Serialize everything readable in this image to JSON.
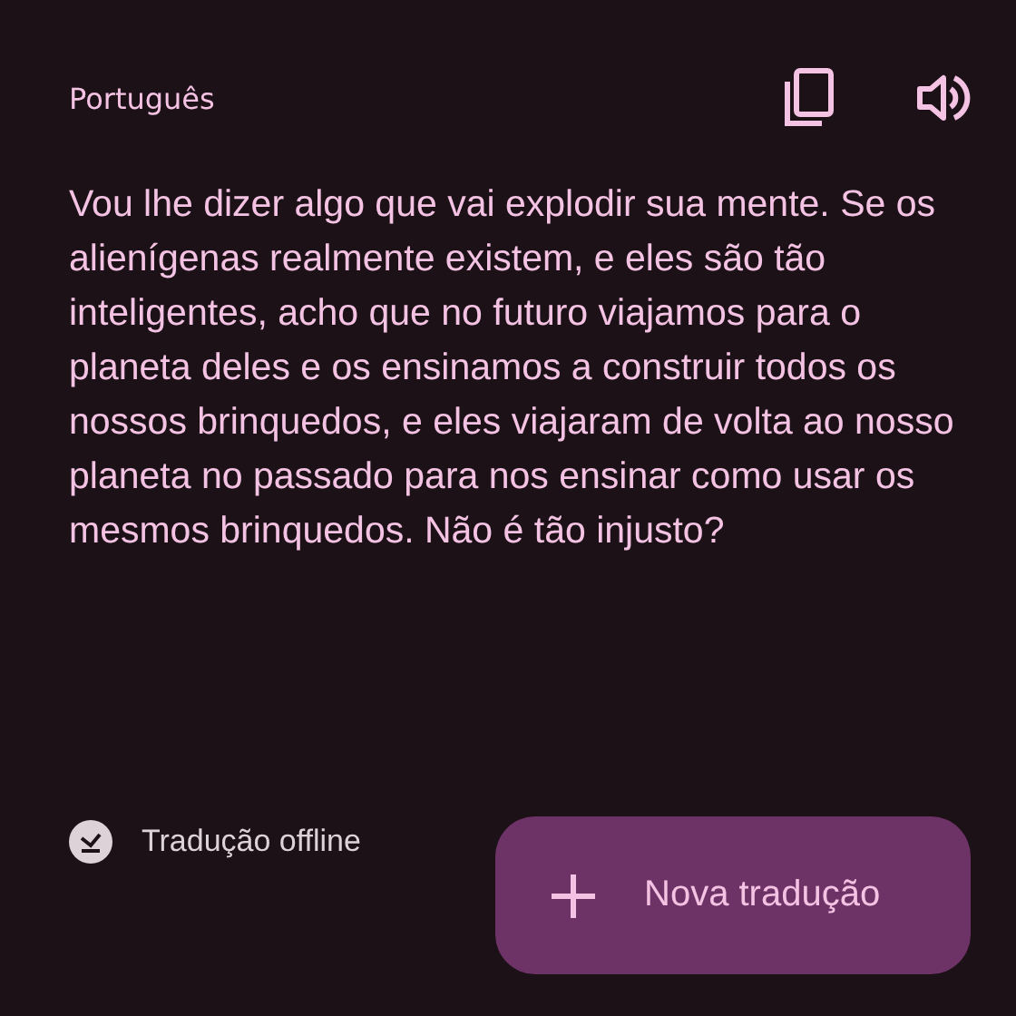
{
  "header": {
    "language": "Português"
  },
  "translation": "Vou lhe dizer algo que vai explodir sua mente. Se os alienígenas realmente existem, e eles são tão inteligentes, acho que no futuro viajamos para o planeta deles e os ensinamos a construir todos os nossos brinquedos, e eles viajaram de volta ao nosso planeta no passado para nos ensinar como usar os mesmos brinquedos. Não é tão injusto?",
  "offline": {
    "label": "Tradução offline"
  },
  "fab": {
    "label": "Nova tradução"
  }
}
